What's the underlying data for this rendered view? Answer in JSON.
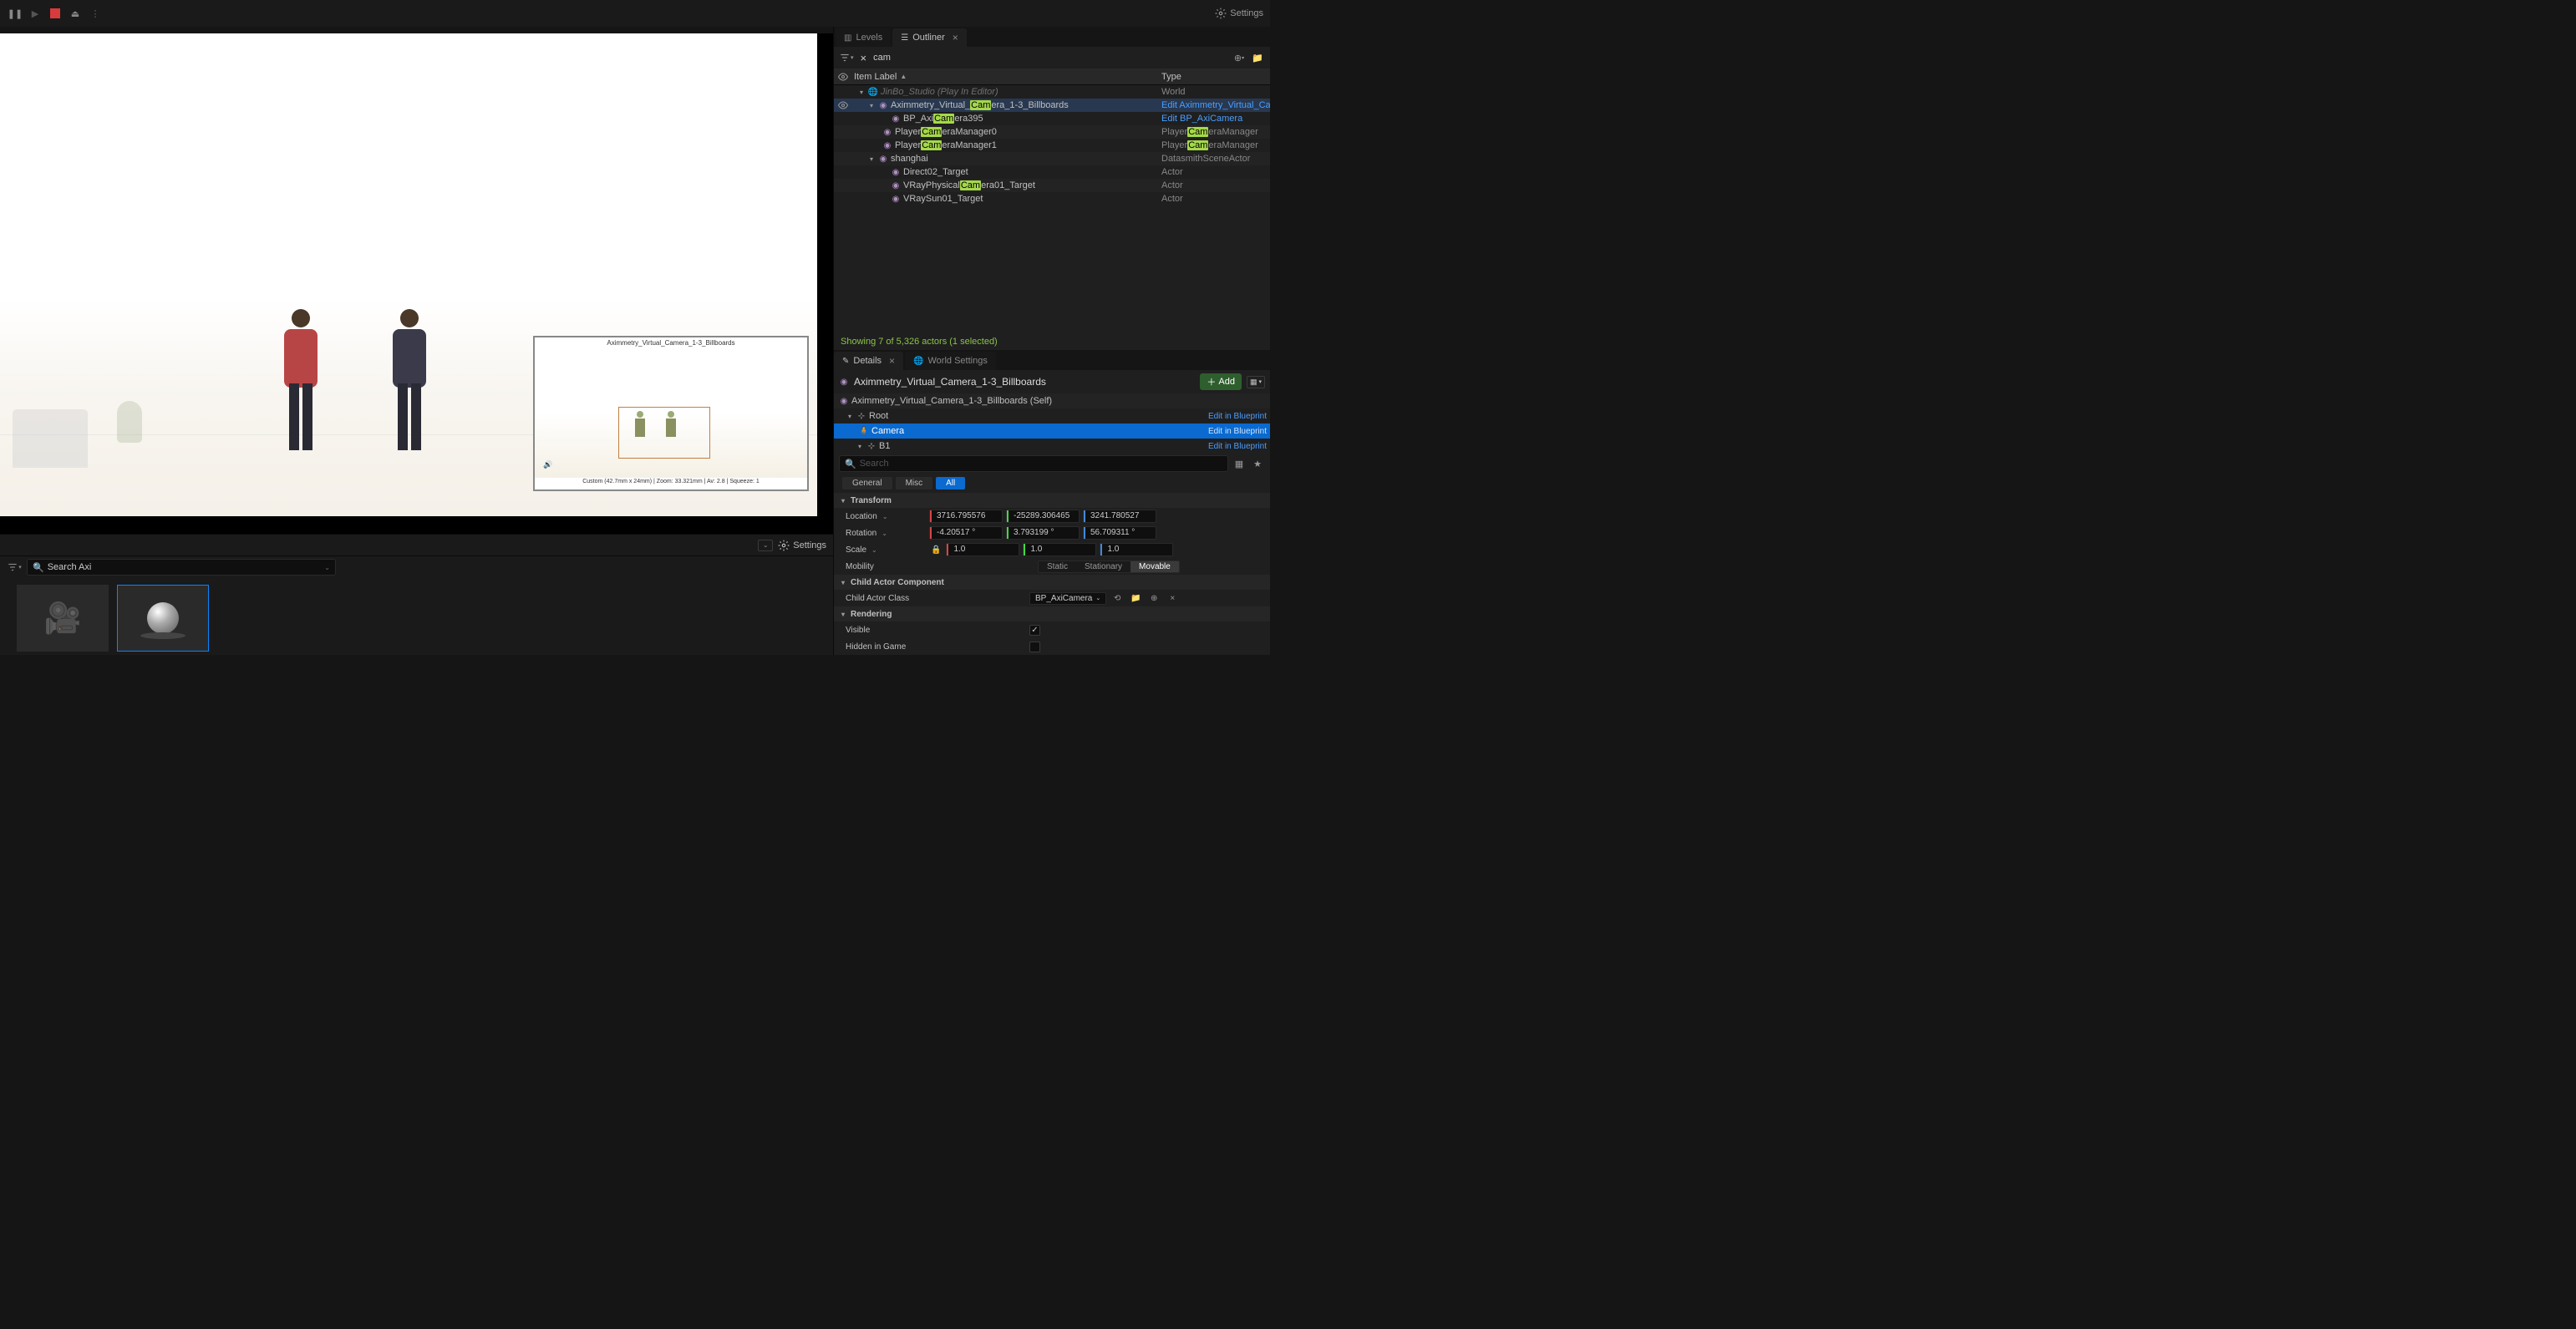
{
  "toolbar": {
    "settings": "Settings"
  },
  "tabs": {
    "levels": "Levels",
    "outliner": "Outliner",
    "details": "Details",
    "world_settings": "World Settings"
  },
  "outliner": {
    "search_value": "cam",
    "col_item": "Item Label",
    "col_type": "Type",
    "rows": [
      {
        "label_pre": "JinBo_Studio (Play In Editor)",
        "type": "World"
      },
      {
        "pre": "Aximmetry_Virtual_",
        "hl": "Cam",
        "post": "era_1-3_Billboards",
        "type": "Edit Aximmetry_Virtual_Cam"
      },
      {
        "pre": "BP_Axi",
        "hl": "Cam",
        "post": "era395",
        "type": "Edit BP_AxiCamera"
      },
      {
        "pre": "Player",
        "hl": "Cam",
        "post": "eraManager0",
        "type_pre": "Player",
        "type_hl": "Cam",
        "type_post": "eraManager"
      },
      {
        "pre": "Player",
        "hl": "Cam",
        "post": "eraManager1",
        "type_pre": "Player",
        "type_hl": "Cam",
        "type_post": "eraManager"
      },
      {
        "pre": "shanghai",
        "type": "DatasmithSceneActor"
      },
      {
        "pre": "Direct02_Target",
        "type": "Actor"
      },
      {
        "pre": "VRayPhysical",
        "hl": "Cam",
        "post": "era01_Target",
        "type": "Actor"
      },
      {
        "pre": "VRaySun01_Target",
        "type": "Actor"
      }
    ],
    "status": "Showing 7 of 5,326 actors (1 selected)"
  },
  "pip": {
    "title": "Aximmetry_Virtual_Camera_1-3_Billboards",
    "footer": "Custom (42.7mm x 24mm) | Zoom: 33.321mm | Av: 2.8 | Squeeze: 1"
  },
  "lower": {
    "settings": "Settings",
    "search_value": "Search Axi"
  },
  "details": {
    "actor_name": "Aximmetry_Virtual_Camera_1-3_Billboards",
    "add": "Add",
    "components": {
      "self": "Aximmetry_Virtual_Camera_1-3_Billboards (Self)",
      "root": "Root",
      "camera": "Camera",
      "b1": "B1",
      "edit": "Edit in Blueprint"
    },
    "search_placeholder": "Search",
    "filters": {
      "general": "General",
      "misc": "Misc",
      "all": "All"
    },
    "sections": {
      "transform": "Transform",
      "child_actor": "Child Actor Component",
      "rendering": "Rendering"
    },
    "props": {
      "location": "Location",
      "rotation": "Rotation",
      "scale": "Scale",
      "mobility": "Mobility",
      "child_actor_class": "Child Actor Class",
      "visible": "Visible",
      "hidden": "Hidden in Game"
    },
    "location_vals": {
      "x": "3716.795576",
      "y": "-25289.306465",
      "z": "3241.780527"
    },
    "rotation_vals": {
      "x": "-4.20517 °",
      "y": "3.793199 °",
      "z": "56.709311 °"
    },
    "scale_vals": {
      "x": "1.0",
      "y": "1.0",
      "z": "1.0"
    },
    "mobility": {
      "static": "Static",
      "stationary": "Stationary",
      "movable": "Movable"
    },
    "child_class_value": "BP_AxiCamera"
  }
}
